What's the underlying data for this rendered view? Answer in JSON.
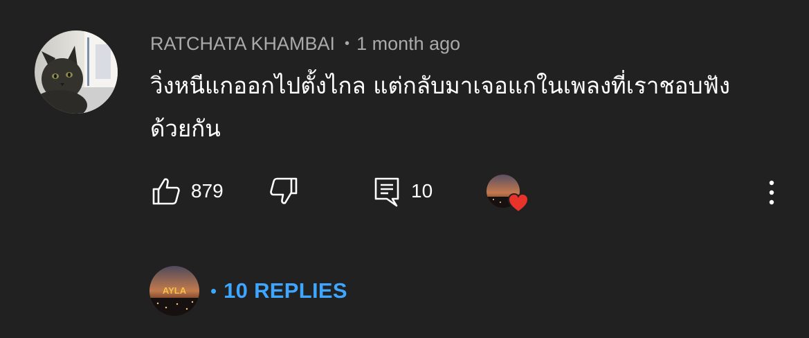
{
  "comment": {
    "author": "RATCHATA KHAMBAI",
    "separator": "•",
    "time": "1 month ago",
    "text_line1": "วิ่งหนีแกออกไปตั้งไกล แต่กลับมาเจอแกในเพลงที่เราชอบฟัง",
    "text_line2": "ด้วยกัน"
  },
  "actions": {
    "like_icon": "thumbs-up-icon",
    "like_count": "879",
    "dislike_icon": "thumbs-down-icon",
    "reply_icon": "comment-icon",
    "reply_count": "10",
    "creator_heart_icon": "heart-icon",
    "more_icon": "more-vertical-icon"
  },
  "replies": {
    "separator": "•",
    "label": "10 REPLIES",
    "avatar_text": "AYLA"
  },
  "colors": {
    "background": "#212121",
    "meta_text": "#aaaaaa",
    "link_blue": "#3ea6ff",
    "heart_red": "#e8332b"
  }
}
